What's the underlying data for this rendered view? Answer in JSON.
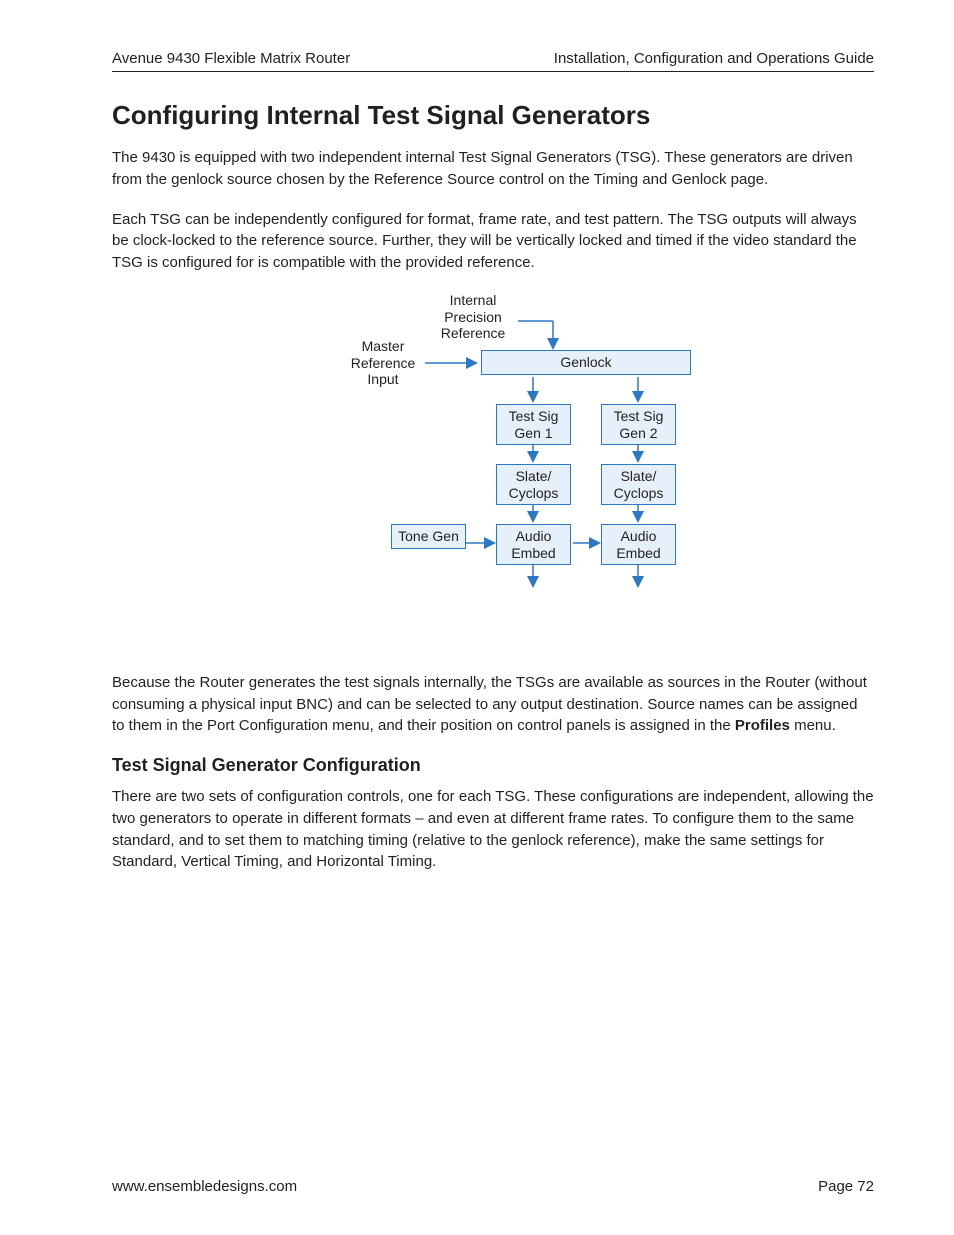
{
  "header": {
    "left": "Avenue 9430 Flexible Matrix Router",
    "right": "Installation, Configuration and Operations Guide"
  },
  "h1": "Configuring Internal Test Signal Generators",
  "p1": "The 9430 is equipped with two independent internal Test Signal Generators (TSG). These generators are driven from the genlock source chosen by the Reference Source control on the Timing and Genlock page.",
  "p2": "Each TSG can be independently configured for format, frame rate, and test pattern. The TSG outputs will always be clock-locked to the reference source. Further, they will be vertically locked and timed if the video standard the TSG is configured for is compatible with the provided reference.",
  "diagram": {
    "internal_precision_reference": "Internal Precision Reference",
    "master_reference_input": "Master Reference Input",
    "genlock": "Genlock",
    "tsg1": "Test Sig Gen 1",
    "tsg2": "Test Sig Gen 2",
    "slate1": "Slate/ Cyclops",
    "slate2": "Slate/ Cyclops",
    "tone_gen": "Tone Gen",
    "audio_embed1": "Audio Embed",
    "audio_embed2": "Audio Embed"
  },
  "p3a": "Because the Router generates the test signals internally, the TSGs are available as sources in the Router (without consuming a physical input BNC) and can be selected to any output destination. Source names can be assigned to them in the Port Configuration menu, and their position on control panels is assigned in the ",
  "p3bold": "Profiles",
  "p3b": " menu.",
  "h2": "Test Signal Generator Configuration",
  "p4": "There are two sets of configuration controls, one for each TSG. These configurations are independent, allowing the two generators to operate in different formats – and even at different frame rates. To configure them to the same standard, and to set them to matching timing (relative to the genlock reference), make the same settings for Standard, Vertical Timing, and Horizontal Timing.",
  "footer": {
    "url": "www.ensembledesigns.com",
    "page": "Page 72"
  }
}
